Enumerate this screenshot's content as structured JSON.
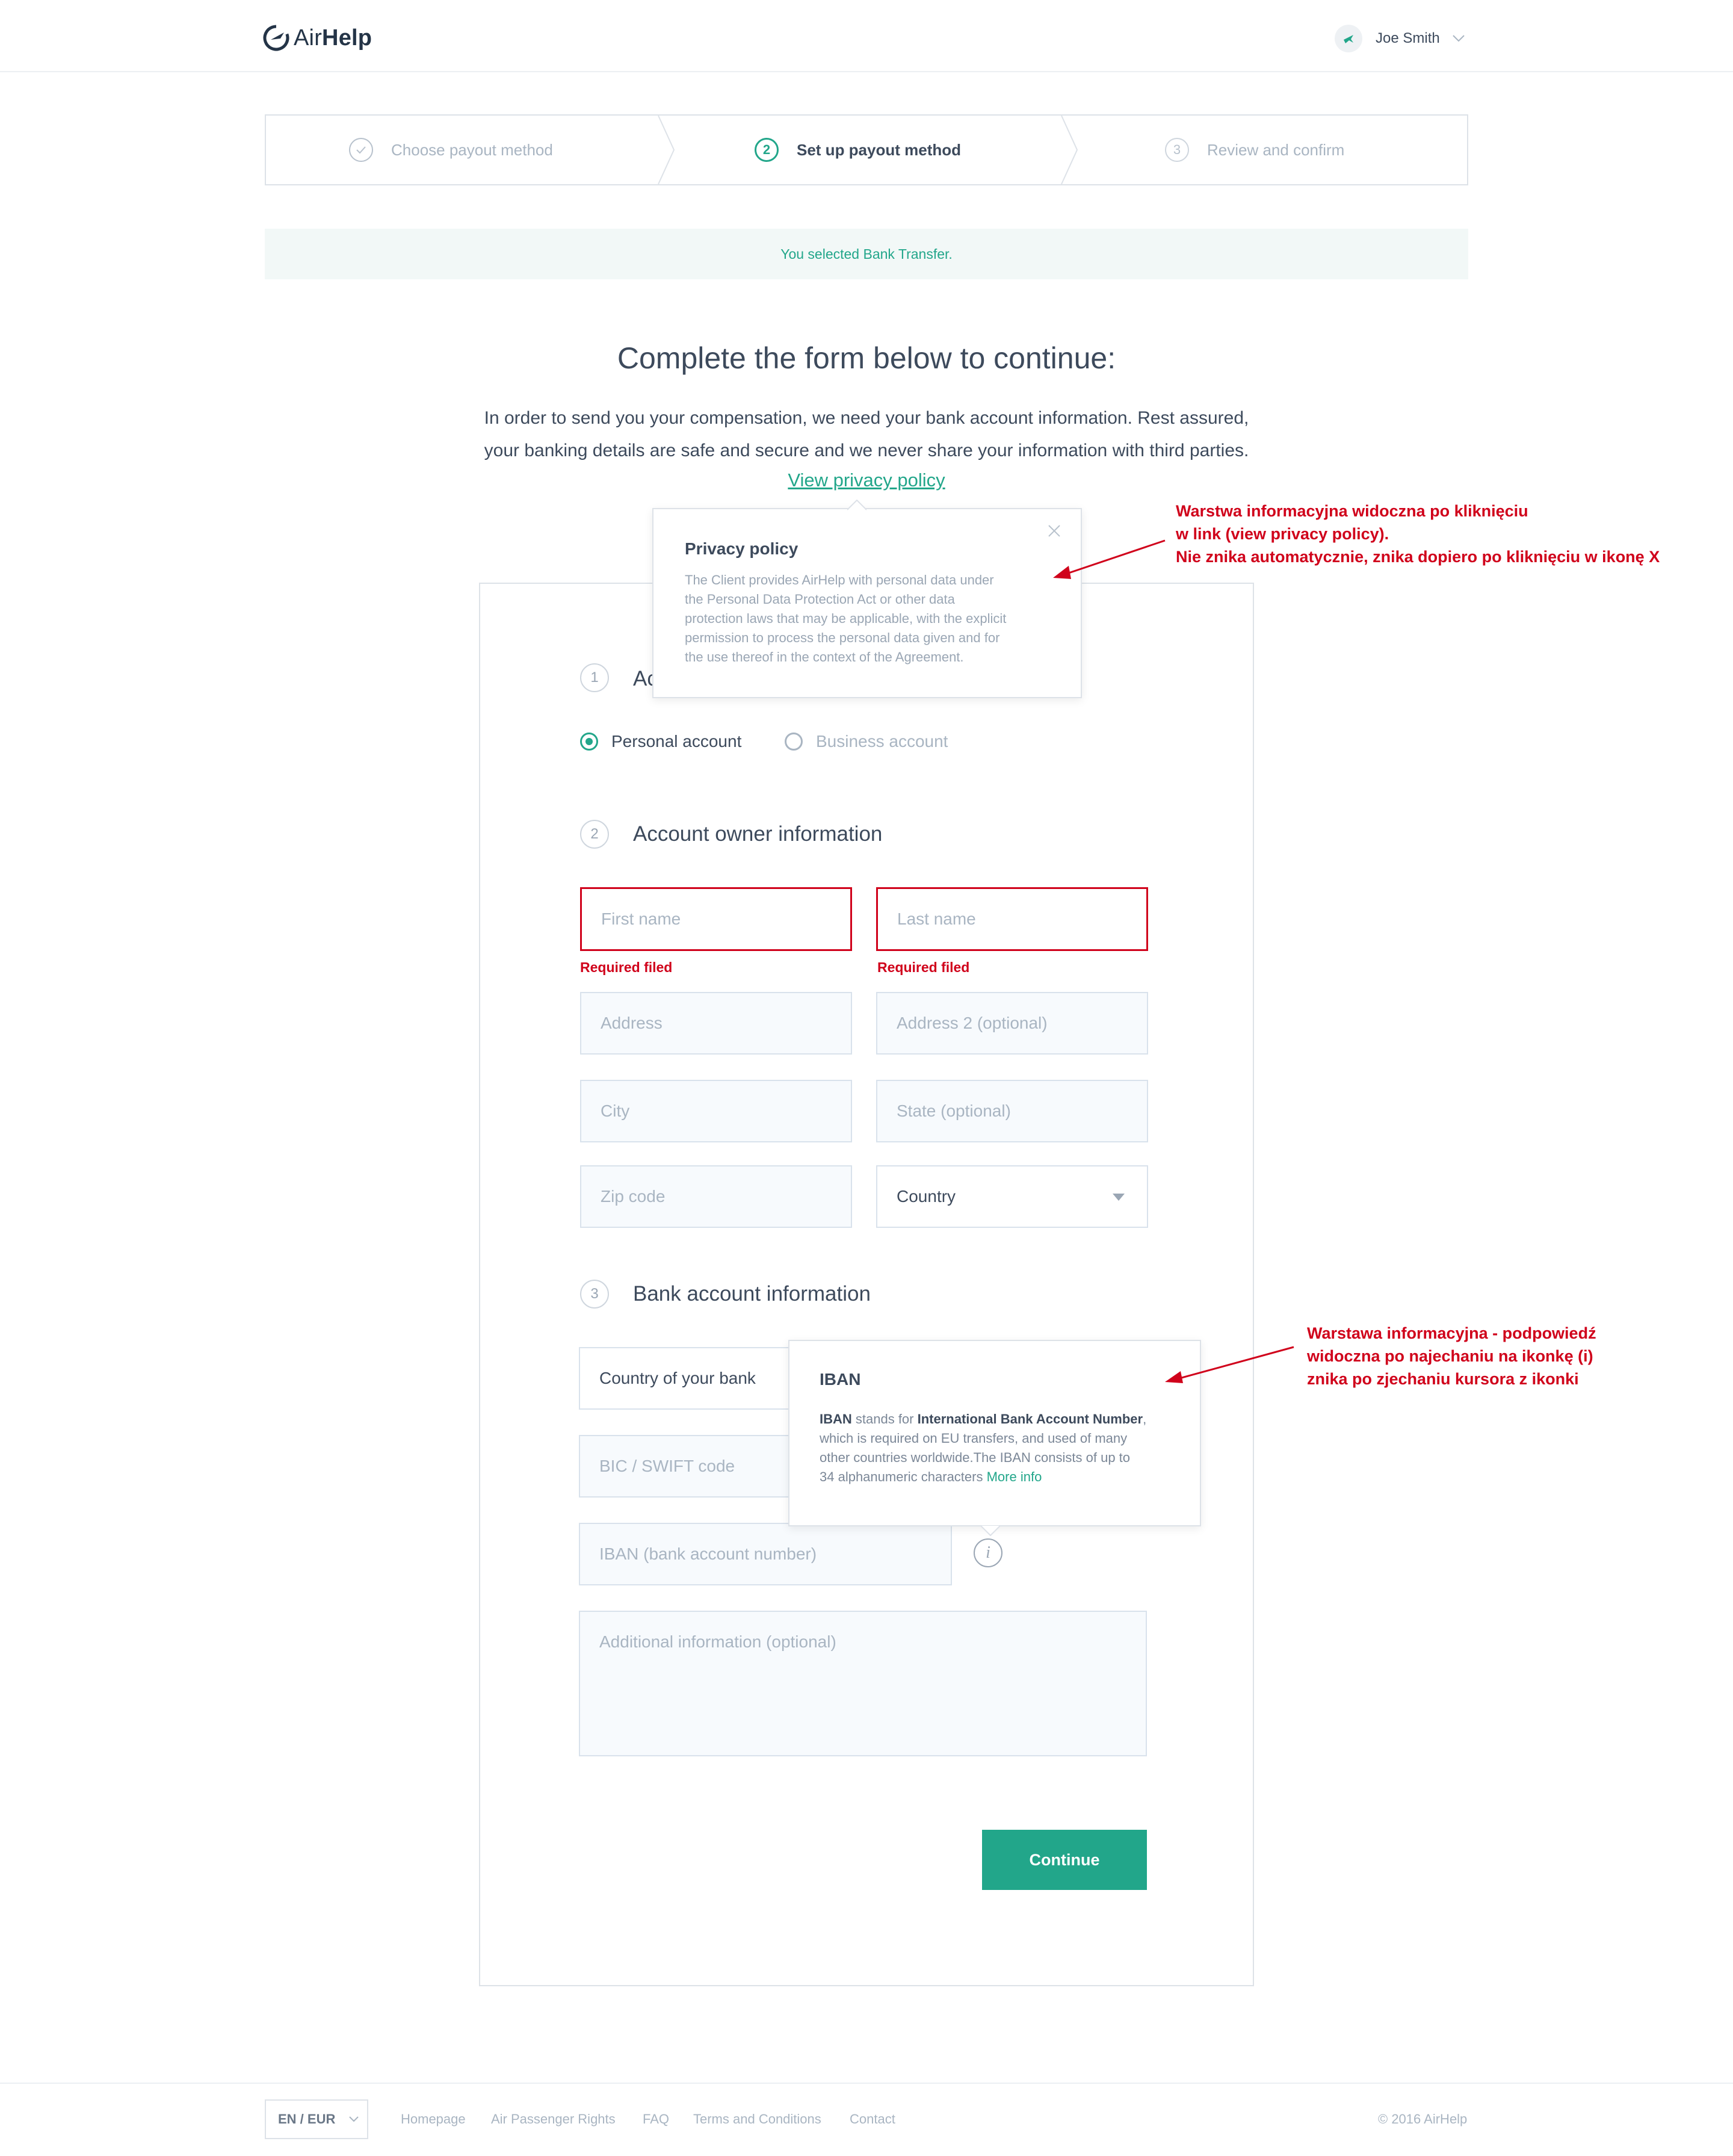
{
  "header": {
    "logo_light": "Air",
    "logo_bold": "Help",
    "user_name": "Joe Smith"
  },
  "steps": [
    {
      "label": "Choose payout method",
      "state": "done",
      "icon": "check-icon"
    },
    {
      "label": "Set up payout method",
      "state": "active",
      "number": "2"
    },
    {
      "label": "Review and confirm",
      "state": "pending",
      "number": "3"
    }
  ],
  "banner": "You selected Bank Transfer.",
  "intro": {
    "title": "Complete the form below to continue:",
    "line1": "In order to send you your compensation, we need your bank account information. Rest assured,",
    "line2": "your banking details are safe and secure and we never share your information with third parties.",
    "privacy_link": "View privacy policy"
  },
  "privacy_popover": {
    "title": "Privacy policy",
    "lines": [
      "The Client provides AirHelp with personal data under",
      "the Personal Data Protection Act or other data",
      "protection laws that may be applicable, with the explicit",
      "permission to process the personal data given and for",
      "the use thereof in the context of the Agreement."
    ]
  },
  "form": {
    "section1": {
      "number": "1",
      "title_visible": "Ac"
    },
    "account_types": [
      {
        "label": "Personal account",
        "selected": true
      },
      {
        "label": "Business account",
        "selected": false
      }
    ],
    "section2": {
      "number": "2",
      "title": "Account owner information"
    },
    "first_name": "First name",
    "last_name": "Last name",
    "error_text": "Required filed",
    "address": "Address",
    "address2": "Address 2 (optional)",
    "city": "City",
    "state": "State (optional)",
    "zip": "Zip code",
    "country": "Country",
    "section3": {
      "number": "3",
      "title": "Bank account information"
    },
    "bank_country": "Country of your bank",
    "bic": "BIC / SWIFT code",
    "iban": "IBAN (bank account number)",
    "info_icon": "i",
    "additional": "Additional information (optional)",
    "continue": "Continue"
  },
  "iban_popover": {
    "title": "IBAN",
    "p1_bold": "IBAN",
    "p1_text": " stands for ",
    "p1_bold2": "International Bank Account Number",
    "p1_end": ",",
    "line2": "which is required on EU transfers, and used of many",
    "line3": "other countries worldwide.The IBAN consists of up to",
    "line4": "34 alphanumeric characters ",
    "more": "More info"
  },
  "annotations": {
    "privacy": [
      "Warstwa informacyjna widoczna po kliknięciu",
      "w link (view privacy policy).",
      "Nie znika automatycznie, znika dopiero po kliknięciu w ikonę X"
    ],
    "iban": [
      "Warstawa informacyjna - podpowiedź",
      "widoczna po najechaniu na ikonkę (i)",
      "znika po zjechaniu kursora z ikonki"
    ]
  },
  "footer": {
    "lang": "EN / EUR",
    "links": [
      "Homepage",
      "Air Passenger Rights",
      "FAQ",
      "Terms and Conditions",
      "Contact"
    ],
    "copyright": "© 2016 AirHelp"
  },
  "colors": {
    "accent": "#22a68a",
    "error": "#d0021b",
    "text": "#3d4a5c",
    "muted": "#a9b5c2"
  }
}
